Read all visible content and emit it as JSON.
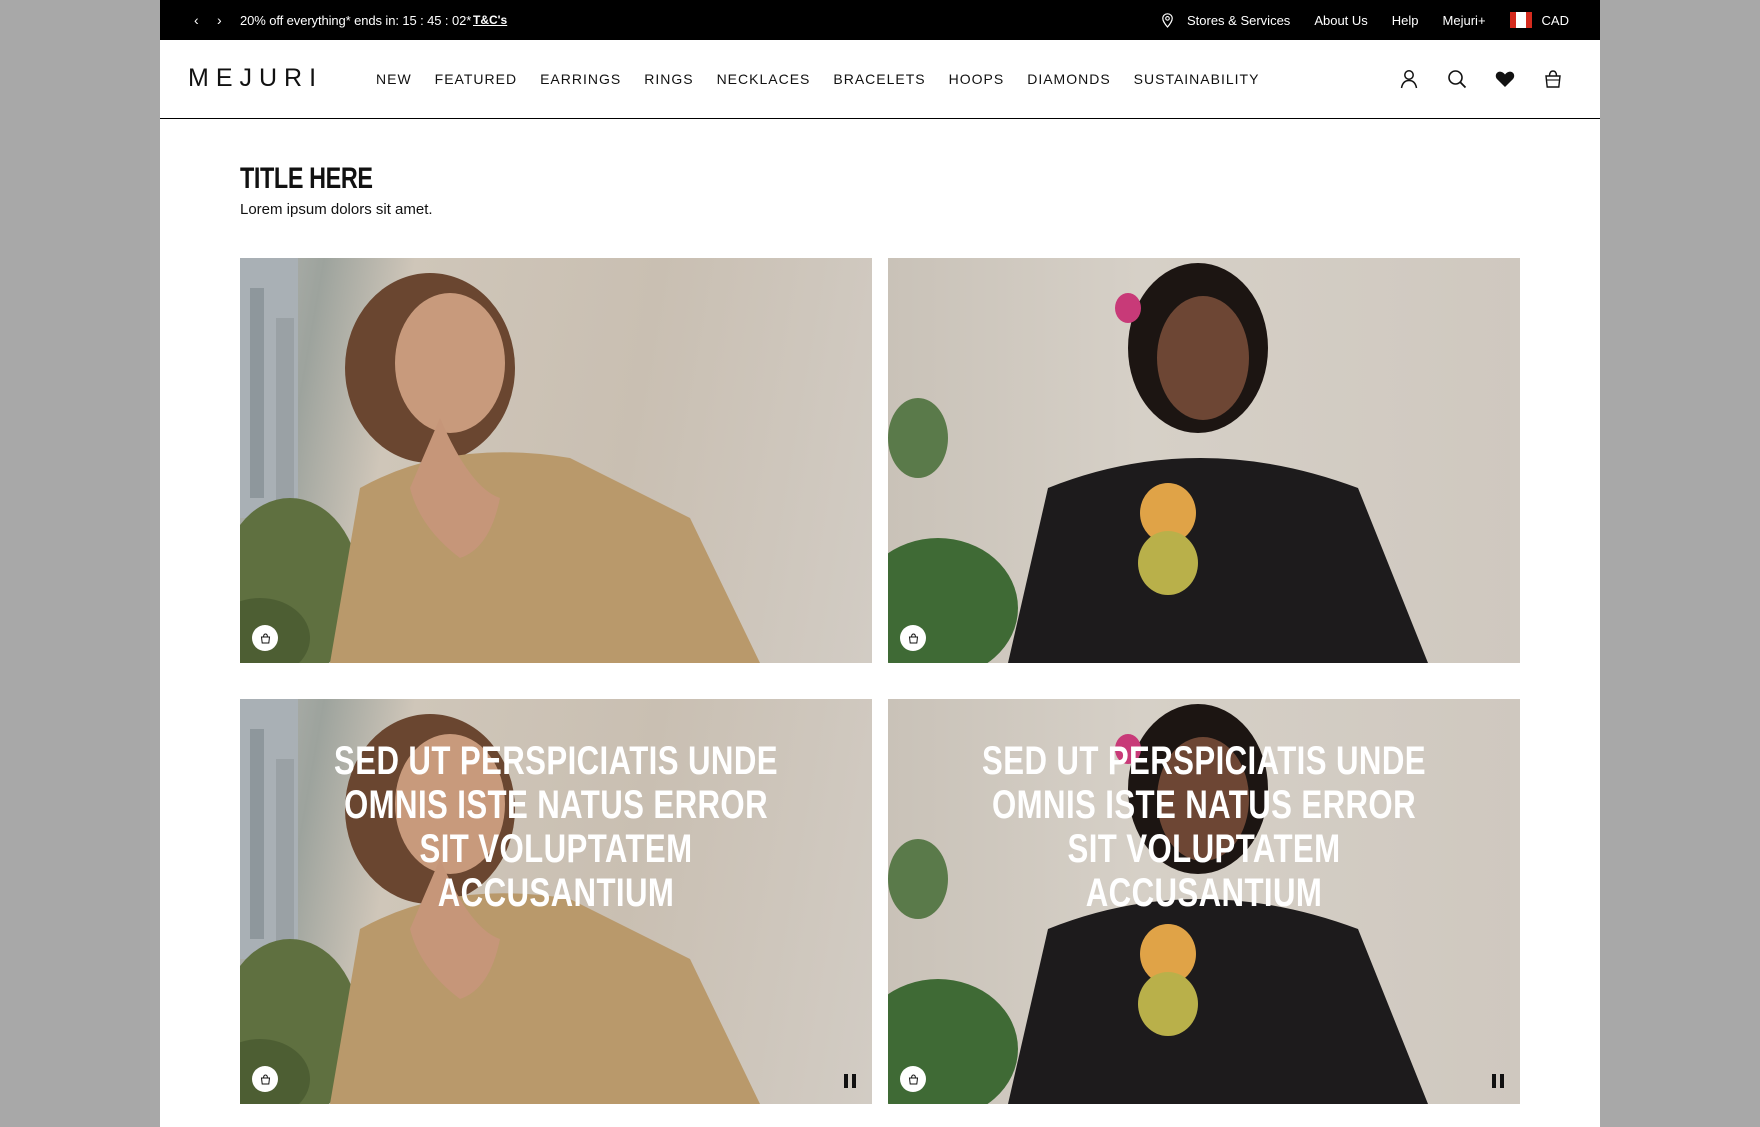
{
  "promo_bar": {
    "prev_label": "‹",
    "next_label": "›",
    "message": "20% off everything* ends in: 15 : 45 : 02*",
    "terms_link": "T&C's",
    "stores_label": "Stores & Services",
    "about_label": "About Us",
    "help_label": "Help",
    "plus_label": "Mejuri+",
    "currency_label": "CAD"
  },
  "header": {
    "logo": "MEJURI",
    "nav": [
      "NEW",
      "FEATURED",
      "EARRINGS",
      "RINGS",
      "NECKLACES",
      "BRACELETS",
      "HOOPS",
      "DIAMONDS",
      "SUSTAINABILITY"
    ]
  },
  "content": {
    "title": "TITLE HERE",
    "subtitle": "Lorem ipsum dolors sit amet.",
    "tiles": [
      {
        "overlay": ""
      },
      {
        "overlay": ""
      },
      {
        "overlay": "SED UT PERSPICIATIS UNDE OMNIS ISTE NATUS ERROR SIT VOLUPTATEM ACCUSANTIUM"
      },
      {
        "overlay": "SED UT PERSPICIATIS UNDE OMNIS ISTE NATUS ERROR SIT VOLUPTATEM ACCUSANTIUM"
      }
    ]
  },
  "colors": {
    "promo_bg": "#000000",
    "page_bg": "#ffffff",
    "outer_bg": "#a8a8a8",
    "text": "#111111"
  },
  "icons": {
    "promo": [
      "chevron-left-icon",
      "chevron-right-icon",
      "location-pin-icon",
      "canada-flag-icon"
    ],
    "header": [
      "account-icon",
      "search-icon",
      "heart-icon",
      "bag-icon"
    ],
    "tiles": [
      "shopping-bag-icon",
      "pause-icon"
    ]
  }
}
